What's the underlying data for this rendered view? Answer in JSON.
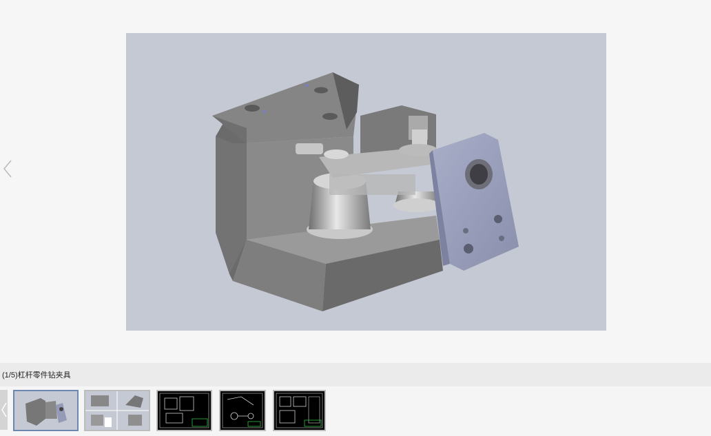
{
  "viewer": {
    "caption": "(1/5)杠杆零件钻夹具",
    "prev_icon": "chevron-left-icon",
    "thumbnails": [
      {
        "index": 1,
        "kind": "3d-render"
      },
      {
        "index": 2,
        "kind": "3d-multiview"
      },
      {
        "index": 3,
        "kind": "cad-drawing"
      },
      {
        "index": 4,
        "kind": "cad-drawing"
      },
      {
        "index": 5,
        "kind": "cad-drawing"
      }
    ],
    "active_thumbnail": 1
  },
  "colors": {
    "stage_bg": "#f6f6f6",
    "render_bg": "#c5c9d3",
    "caption_bg": "#ebebeb",
    "active_border": "#6c87b1",
    "cad_bg": "#000000"
  }
}
